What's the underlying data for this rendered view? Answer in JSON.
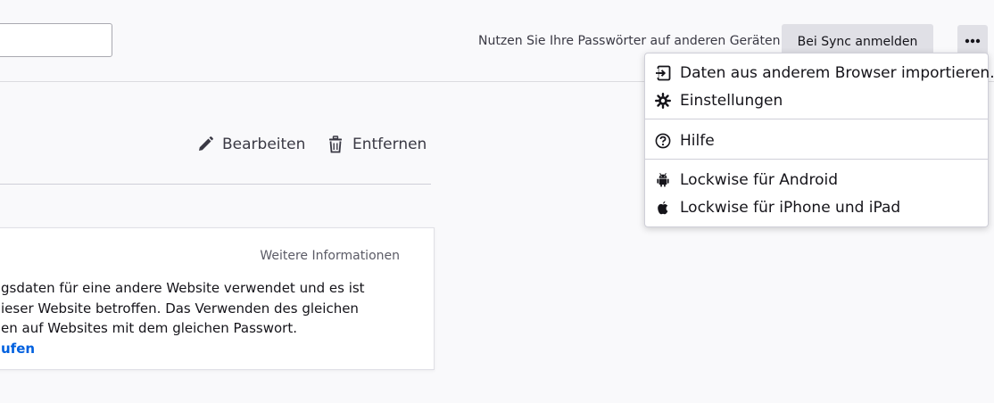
{
  "header": {
    "search_value": "",
    "sync_promo_text": "Nutzen Sie Ihre Passwörter auf anderen Geräten",
    "sync_button_label": "Bei Sync anmelden",
    "menu_button_icon": "more-horizontal-icon"
  },
  "actions": {
    "edit_label": "Bearbeiten",
    "edit_icon": "pencil-icon",
    "remove_label": "Entfernen",
    "remove_icon": "trash-icon"
  },
  "info_card": {
    "more_info_label": "Weitere Informationen",
    "lines": [
      "gsdaten für eine andere Website verwendet und es ist",
      "ieser Website betroffen. Das Verwenden des gleichen",
      "en auf Websites mit dem gleichen Passwort."
    ],
    "link_label": "ufen",
    "link_color": "#0060df"
  },
  "menu": {
    "items": [
      {
        "label": "Daten aus anderem Browser importieren...",
        "icon": "import-icon"
      },
      {
        "label": "Einstellungen",
        "icon": "gear-icon"
      },
      {
        "label": "Hilfe",
        "icon": "help-icon"
      },
      {
        "label": "Lockwise für Android",
        "icon": "android-icon"
      },
      {
        "label": "Lockwise für iPhone und iPad",
        "icon": "apple-icon"
      }
    ]
  }
}
